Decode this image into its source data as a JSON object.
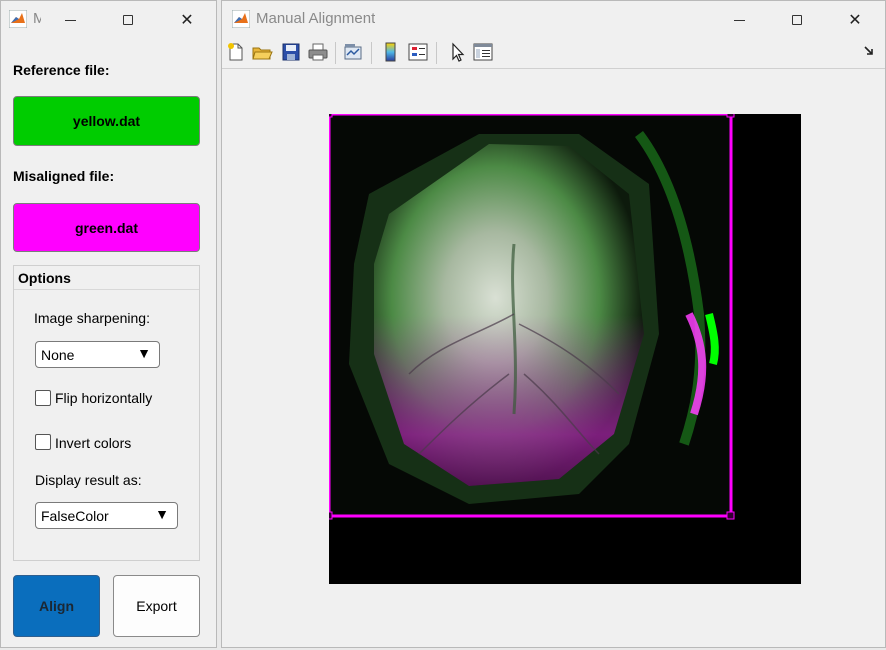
{
  "options_window": {
    "title": "M",
    "reference_label": "Reference file:",
    "reference_file": "yellow.dat",
    "misaligned_label": "Misaligned file:",
    "misaligned_file": "green.dat",
    "options": {
      "title": "Options",
      "sharpening_label": "Image sharpening:",
      "sharpening_value": "None",
      "flip_label": "Flip horizontally",
      "flip_checked": false,
      "invert_label": "Invert colors",
      "invert_checked": false,
      "display_label": "Display result as:",
      "display_value": "FalseColor"
    },
    "align_label": "Align",
    "export_label": "Export"
  },
  "figure_window": {
    "title": "Manual Alignment",
    "toolbar": [
      "new-file-icon",
      "open-folder-icon",
      "save-icon",
      "print-icon",
      "link-plot-icon",
      "colorbar-icon",
      "legend-icon",
      "pointer-icon",
      "property-inspector-icon"
    ]
  },
  "colors": {
    "reference_green": "#00cc00",
    "misaligned_magenta": "#ff00ff",
    "align_blue": "#0a6ebd",
    "roi_border": "#ff00ff"
  }
}
